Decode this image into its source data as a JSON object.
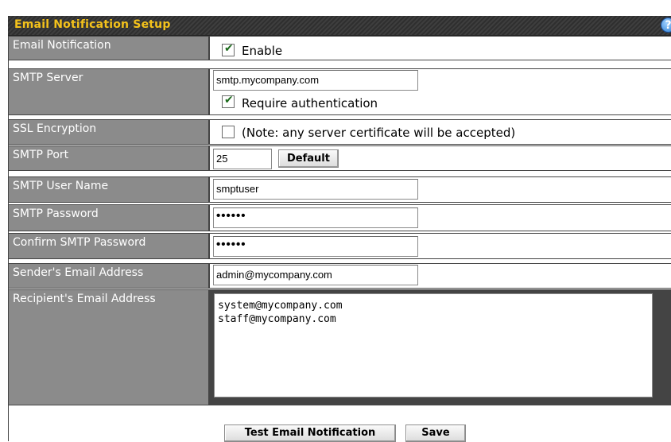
{
  "section": {
    "title": "Email Notification Setup",
    "help_icon": "?"
  },
  "rows": {
    "email_notification": {
      "label": "Email Notification",
      "enable_checked": true,
      "enable_label": "Enable"
    },
    "smtp_server": {
      "label": "SMTP Server",
      "value": "smtp.mycompany.com",
      "require_auth_checked": true,
      "require_auth_label": "Require authentication"
    },
    "ssl": {
      "label": "SSL Encryption",
      "checked": false,
      "note": "(Note: any server certificate will be accepted)"
    },
    "smtp_port": {
      "label": "SMTP Port",
      "value": "25",
      "default_button": "Default"
    },
    "smtp_user": {
      "label": "SMTP User Name",
      "value": "smptuser"
    },
    "smtp_password": {
      "label": "SMTP Password",
      "value": "••••••"
    },
    "confirm_password": {
      "label": "Confirm SMTP Password",
      "value": "••••••"
    },
    "sender": {
      "label": "Sender's Email Address",
      "value": "admin@mycompany.com"
    },
    "recipient": {
      "label": "Recipient's Email Address",
      "value": "system@mycompany.com\nstaff@mycompany.com"
    }
  },
  "buttons": {
    "test": "Test Email Notification",
    "save": "Save"
  },
  "colors": {
    "header_text": "#f4c21b",
    "label_bg": "#8b8b8b",
    "grid": "#444444"
  }
}
